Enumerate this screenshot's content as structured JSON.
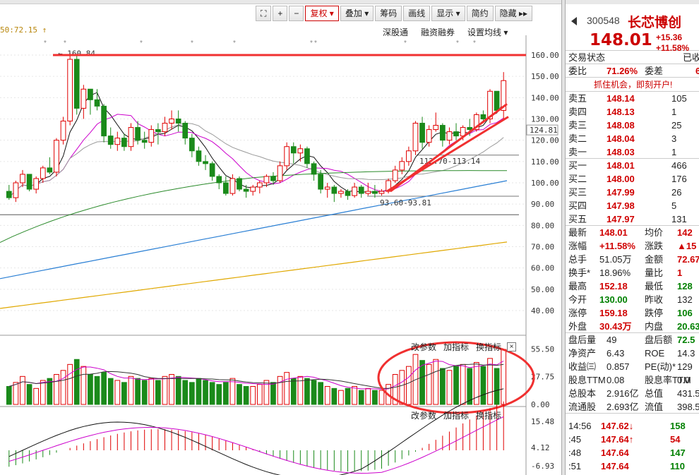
{
  "toolbar": {
    "icons": [
      "lock-icon",
      "zoom-in-icon",
      "zoom-out-icon"
    ],
    "buttons": [
      {
        "label": "复权",
        "dropdown": true,
        "selected": true
      },
      {
        "label": "叠加",
        "dropdown": true
      },
      {
        "label": "筹码"
      },
      {
        "label": "画线"
      },
      {
        "label": "显示",
        "dropdown": true
      },
      {
        "label": "简约"
      },
      {
        "label": "隐藏"
      }
    ],
    "expand_glyph": "▸▸",
    "zoom_in": "+",
    "zoom_out": "−"
  },
  "readout": "50:72.15 ↑",
  "top_links": [
    "深股通",
    "融资融券",
    "设置均线 ▾"
  ],
  "price_chart": {
    "max_label": "160.84",
    "zone_label": "112.70-113.14",
    "low_label": "93.60-93.81",
    "current_tag": "124.81",
    "axis_ticks": [
      "160.00",
      "150.00",
      "140.00",
      "130.00",
      "120.00",
      "110.00",
      "100.00",
      "90.00",
      "80.00",
      "70.00",
      "60.00",
      "50.00",
      "40.00"
    ]
  },
  "volume_chart": {
    "links": [
      "改参数",
      "加指标",
      "换指标"
    ],
    "close_icon": "×",
    "axis_ticks": [
      "55.50",
      "27.75",
      "0.00"
    ]
  },
  "macd_chart": {
    "links": [
      "改参数",
      "加指标",
      "换指标"
    ],
    "axis_ticks": [
      "15.48",
      "4.12",
      "-6.93"
    ]
  },
  "chart_data": {
    "type": "candlestick",
    "ylim": [
      35,
      165
    ],
    "ohlc": [
      [
        96,
        99,
        92,
        93
      ],
      [
        93,
        101,
        91,
        100
      ],
      [
        100,
        106,
        98,
        104
      ],
      [
        104,
        104,
        96,
        97
      ],
      [
        97,
        103,
        95,
        102
      ],
      [
        102,
        108,
        100,
        107
      ],
      [
        107,
        112,
        104,
        105
      ],
      [
        105,
        121,
        103,
        120
      ],
      [
        120,
        131,
        118,
        129
      ],
      [
        129,
        161,
        127,
        158
      ],
      [
        158,
        160,
        132,
        135
      ],
      [
        135,
        146,
        130,
        144
      ],
      [
        144,
        143,
        132,
        139
      ],
      [
        139,
        144,
        134,
        136
      ],
      [
        136,
        137,
        119,
        122
      ],
      [
        122,
        126,
        116,
        118
      ],
      [
        118,
        124,
        115,
        121
      ],
      [
        121,
        123,
        115,
        117
      ],
      [
        117,
        128,
        115,
        126
      ],
      [
        126,
        129,
        118,
        120
      ],
      [
        120,
        124,
        116,
        119
      ],
      [
        119,
        127,
        117,
        125
      ],
      [
        125,
        128,
        118,
        124
      ],
      [
        124,
        131,
        122,
        128
      ],
      [
        128,
        134,
        125,
        130
      ],
      [
        130,
        134,
        124,
        128
      ],
      [
        128,
        129,
        118,
        121
      ],
      [
        121,
        123,
        112,
        115
      ],
      [
        115,
        117,
        108,
        110
      ],
      [
        110,
        113,
        106,
        109
      ],
      [
        109,
        110,
        101,
        103
      ],
      [
        103,
        104,
        97,
        100
      ],
      [
        100,
        103,
        94,
        95
      ],
      [
        95,
        104,
        94,
        102
      ],
      [
        102,
        103,
        96,
        97
      ],
      [
        97,
        99,
        93,
        96
      ],
      [
        96,
        99,
        94,
        98
      ],
      [
        98,
        101,
        95,
        100
      ],
      [
        100,
        104,
        98,
        103
      ],
      [
        103,
        105,
        99,
        101
      ],
      [
        101,
        110,
        100,
        108
      ],
      [
        108,
        119,
        106,
        117
      ],
      [
        117,
        119,
        109,
        114
      ],
      [
        114,
        118,
        110,
        116
      ],
      [
        116,
        117,
        107,
        109
      ],
      [
        109,
        110,
        101,
        104
      ],
      [
        104,
        106,
        95,
        97
      ],
      [
        97,
        100,
        93,
        98
      ],
      [
        98,
        99,
        91,
        95
      ],
      [
        95,
        97,
        93,
        96
      ],
      [
        96,
        97,
        92,
        94
      ],
      [
        94,
        100,
        93,
        98
      ],
      [
        98,
        99,
        93,
        95
      ],
      [
        95,
        100,
        94,
        96
      ],
      [
        96,
        99,
        93,
        95
      ],
      [
        95,
        97,
        94,
        96
      ],
      [
        96,
        102,
        95,
        101
      ],
      [
        101,
        108,
        100,
        106
      ],
      [
        106,
        112,
        104,
        110
      ],
      [
        110,
        117,
        108,
        115
      ],
      [
        115,
        129,
        113,
        128
      ],
      [
        128,
        131,
        116,
        119
      ],
      [
        119,
        127,
        117,
        125
      ],
      [
        125,
        133,
        124,
        127
      ],
      [
        127,
        128,
        117,
        120
      ],
      [
        120,
        126,
        118,
        124
      ],
      [
        124,
        128,
        120,
        122
      ],
      [
        122,
        127,
        120,
        126
      ],
      [
        126,
        130,
        122,
        125
      ],
      [
        125,
        133,
        124,
        132
      ],
      [
        132,
        134,
        128,
        130
      ],
      [
        130,
        144,
        128,
        143
      ],
      [
        143,
        141,
        133,
        134
      ],
      [
        134,
        152,
        130,
        148
      ]
    ],
    "volume": [
      18,
      22,
      28,
      20,
      16,
      24,
      26,
      30,
      34,
      40,
      45,
      38,
      30,
      28,
      32,
      26,
      24,
      22,
      28,
      26,
      24,
      26,
      24,
      28,
      30,
      28,
      24,
      22,
      26,
      24,
      22,
      20,
      22,
      26,
      20,
      18,
      18,
      20,
      24,
      22,
      28,
      32,
      26,
      28,
      26,
      24,
      22,
      18,
      16,
      14,
      16,
      18,
      14,
      16,
      14,
      14,
      20,
      30,
      34,
      38,
      50,
      44,
      40,
      45,
      36,
      34,
      38,
      40,
      36,
      42,
      38,
      46,
      36,
      55
    ],
    "volume_up": [
      0,
      1,
      1,
      0,
      1,
      1,
      0,
      1,
      1,
      1,
      0,
      1,
      0,
      0,
      0,
      0,
      1,
      0,
      1,
      0,
      0,
      1,
      0,
      1,
      1,
      0,
      0,
      0,
      0,
      0,
      0,
      0,
      0,
      1,
      0,
      0,
      1,
      1,
      1,
      0,
      1,
      1,
      0,
      1,
      0,
      0,
      0,
      1,
      0,
      1,
      0,
      1,
      0,
      1,
      0,
      1,
      1,
      1,
      1,
      1,
      1,
      0,
      1,
      1,
      0,
      1,
      0,
      1,
      0,
      1,
      0,
      1,
      0,
      1
    ]
  }
}
